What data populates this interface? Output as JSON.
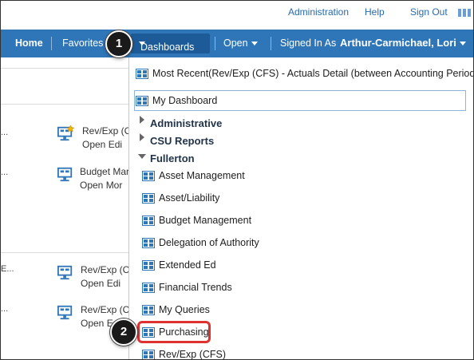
{
  "utility": {
    "administration": "Administration",
    "help": "Help",
    "sign_out": "Sign Out"
  },
  "nav": {
    "home": "Home",
    "favorites": "Favorites",
    "dashboards": "Dashboards",
    "open": "Open",
    "signed_in_as": "Signed In As",
    "user_name": "Arthur-Carmichael, Lori"
  },
  "background": {
    "dots": [
      "...",
      "...",
      "E...",
      "..."
    ],
    "tiles": [
      {
        "title": "Rev/Exp (C",
        "links": "Open  Edi"
      },
      {
        "title": "Budget Mar",
        "links": "Open  Mor"
      },
      {
        "title": "Rev/Exp (C",
        "links": "Open  Edi"
      },
      {
        "title": "Rev/Exp (C",
        "links": "Open  E"
      }
    ]
  },
  "menu": {
    "most_recent": "Most Recent(Rev/Exp (CFS) - Actuals Detail (between Accounting Periods))",
    "my_dashboard": "My Dashboard",
    "categories": [
      "Administrative",
      "CSU Reports",
      "Fullerton"
    ],
    "fullerton_items": [
      "Asset Management",
      "Asset/Liability",
      "Budget Management",
      "Delegation of Authority",
      "Extended Ed",
      "Financial Trends",
      "My Queries",
      "Purchasing",
      "Rev/Exp (CFS)"
    ]
  },
  "steps": {
    "one": "1",
    "two": "2"
  },
  "colors": {
    "nav_bg": "#2f76b8",
    "nav_active": "#1c5b98",
    "highlight": "#e03131",
    "link": "#2a6aa8"
  }
}
